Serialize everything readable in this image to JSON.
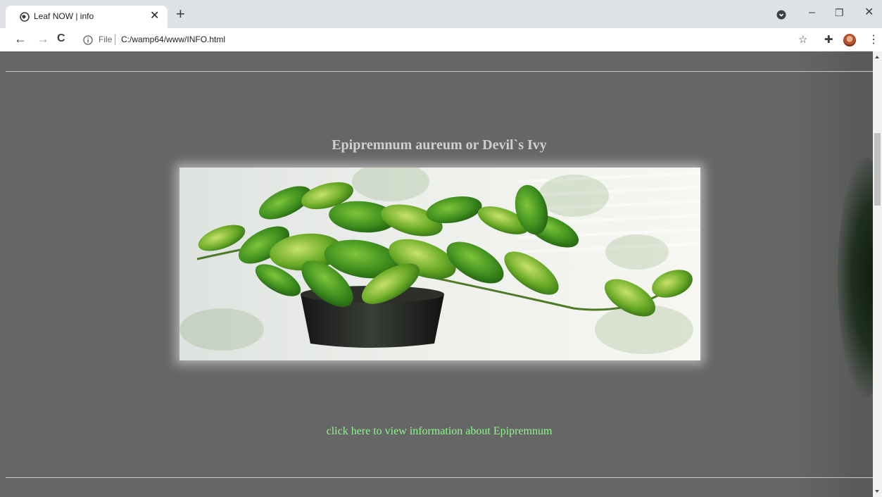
{
  "browser": {
    "tab": {
      "title": "Leaf NOW | info",
      "close_icon": "✕"
    },
    "new_tab_label": "+",
    "window_controls": {
      "minimize": "–",
      "restore": "❐",
      "close": "✕"
    },
    "nav": {
      "back": "←",
      "forward": "→",
      "reload": "C"
    },
    "address": {
      "scheme_label": "File",
      "url": "C:/wamp64/www/INFO.html"
    },
    "toolbar_icons": {
      "bookmark": "☆",
      "extensions": "✚",
      "menu": "⋮"
    }
  },
  "page": {
    "plant_title": "Epipremnum aureum or Devil`s Ivy",
    "plant_image_alt": "Potted Epipremnum aureum plant",
    "info_link": "click here to view information about Epipremnum",
    "colors": {
      "background": "#666666",
      "title": "#cfcfcf",
      "link": "#8ef58e",
      "rule": "#c9c9c9"
    }
  }
}
